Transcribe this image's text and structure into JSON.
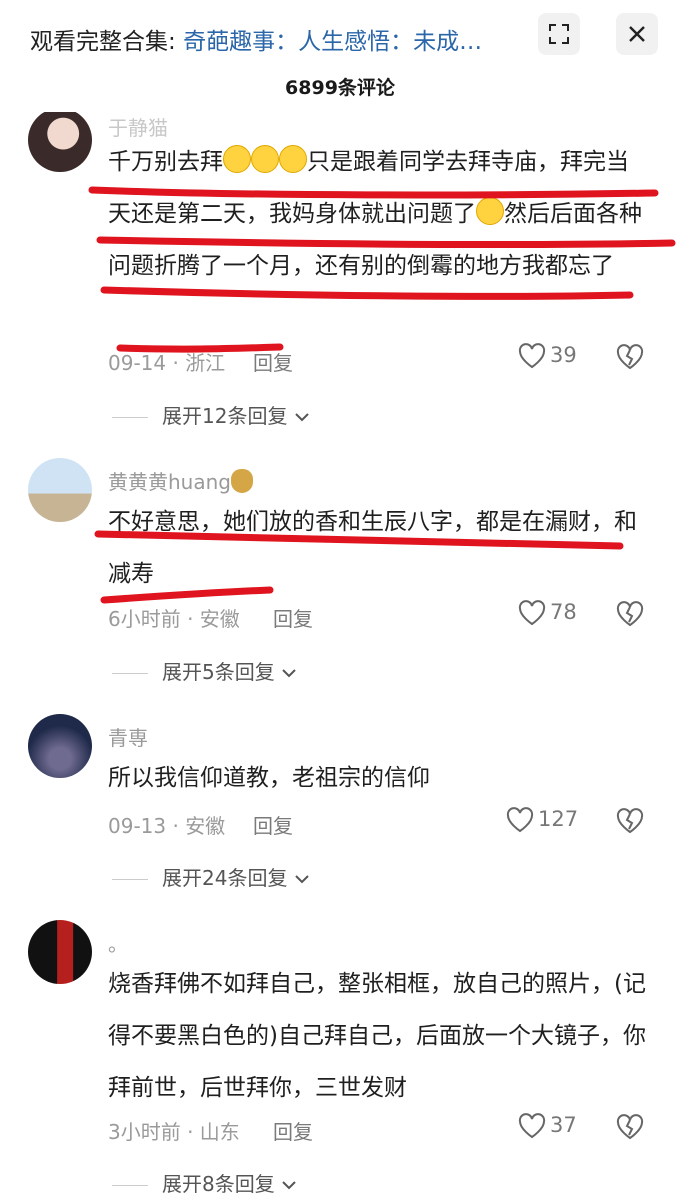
{
  "header": {
    "collection_prefix": "观看完整合集: ",
    "collection_title": "奇葩趣事：人生感悟：未成…",
    "comment_count": "6899条评论"
  },
  "comments": [
    {
      "username": "于静猫",
      "text_parts": [
        "千万别去拜",
        "只是跟着同学去拜寺庙，拜完当天还是第二天，我妈身体就出问题了",
        "然后后面各种问题折腾了一个月，还有别的倒霉的地方我都忘了"
      ],
      "date_location": "09-14 · 浙江",
      "reply_label": "回复",
      "likes": "39",
      "expand_label": "展开12条回复"
    },
    {
      "username": "黄黄黄huang",
      "text": "不好意思，她们放的香和生辰八字，都是在漏财，和减寿",
      "date_location": "6小时前 · 安徽",
      "reply_label": "回复",
      "likes": "78",
      "expand_label": "展开5条回复"
    },
    {
      "username": "青専",
      "text": "所以我信仰道教，老祖宗的信仰",
      "date_location": "09-13 · 安徽",
      "reply_label": "回复",
      "likes": "127",
      "expand_label": "展开24条回复"
    },
    {
      "username": "。",
      "text": "烧香拜佛不如拜自己，整张相框，放自己的照片，(记得不要黑白色的)自己拜自己，后面放一个大镜子，你拜前世，后世拜你，三世发财",
      "date_location": "3小时前 · 山东",
      "reply_label": "回复",
      "likes": "37",
      "expand_label": "展开8条回复"
    }
  ],
  "icons": {
    "fullscreen": "fullscreen-icon",
    "close": "close-icon",
    "like": "heart-icon",
    "dislike": "broken-heart-icon",
    "expand": "chevron-down-icon"
  },
  "colors": {
    "link": "#2a66a8",
    "annotation": "#e0141e"
  }
}
